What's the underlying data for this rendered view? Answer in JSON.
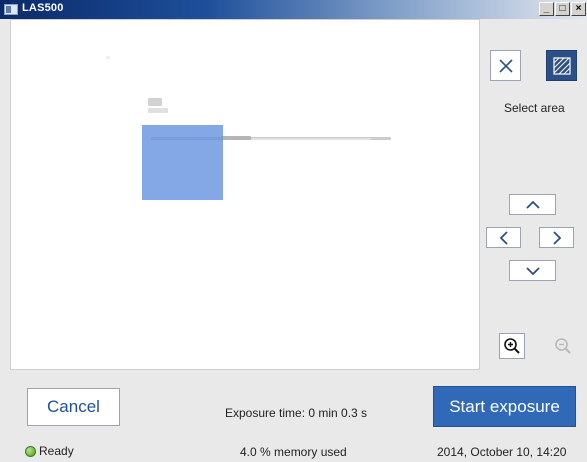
{
  "window": {
    "title": "LAS500",
    "min_glyph": "_",
    "max_glyph": "□",
    "close_glyph": "×"
  },
  "panel": {
    "select_area_label": "Select area"
  },
  "footer": {
    "cancel_label": "Cancel",
    "exposure_time": "Exposure time: 0 min 0.3 s",
    "start_label": "Start exposure",
    "status": "Ready",
    "memory": "4.0 % memory used",
    "datetime": "2014, October 10, 14:20"
  },
  "colors": {
    "accent": "#2f69b7",
    "selection": "#628edf",
    "active_tool": "#2c4f86",
    "status_led": "#4a9a1e"
  },
  "icons": [
    "close-icon",
    "hatch-area-icon",
    "chevron-up-icon",
    "chevron-left-icon",
    "chevron-right-icon",
    "chevron-down-icon",
    "zoom-in-icon",
    "zoom-out-icon"
  ]
}
